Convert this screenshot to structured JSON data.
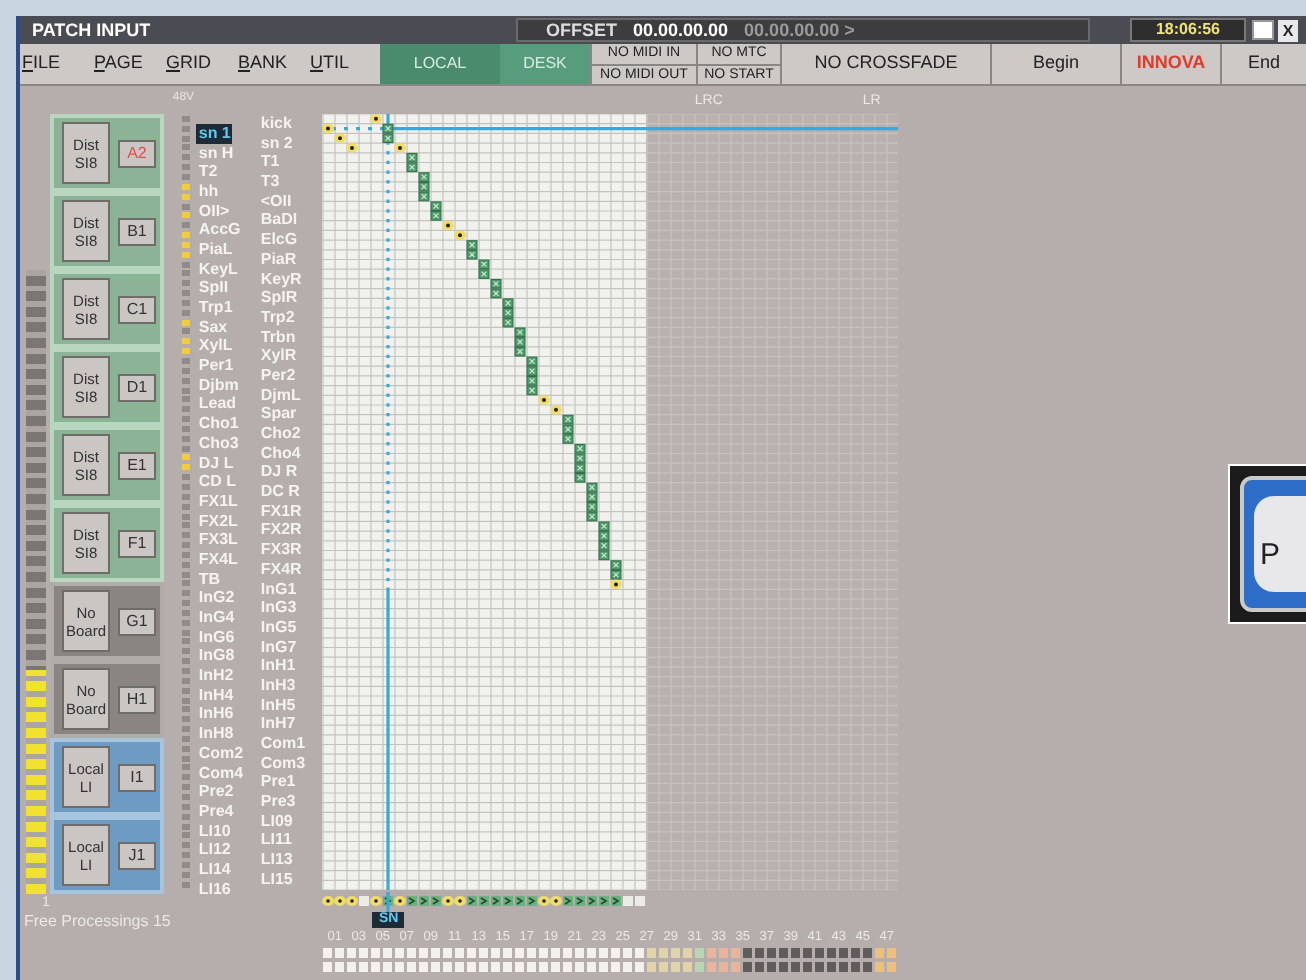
{
  "window": {
    "title": "PATCH INPUT"
  },
  "offset": {
    "label": "OFFSET",
    "value": "00.00.00.00",
    "secondary": "00.00.00.00 >"
  },
  "clock": "18:06:56",
  "title_buttons": [
    {
      "kind": "blank"
    },
    {
      "kind": "close",
      "text": "X"
    }
  ],
  "menu": [
    "FILE",
    "PAGE",
    "GRID",
    "BANK",
    "UTIL"
  ],
  "tabs": [
    {
      "label": "LOCAL",
      "selected": true
    },
    {
      "label": "DESK",
      "selected": false
    }
  ],
  "status": [
    {
      "kind": "stack",
      "lines": [
        "NO MIDI IN",
        "NO MIDI OUT"
      ]
    },
    {
      "kind": "stack",
      "lines": [
        "NO MTC",
        "NO START"
      ]
    },
    {
      "kind": "plain",
      "text": "NO CROSSFADE"
    },
    {
      "kind": "plain",
      "text": "Begin"
    },
    {
      "kind": "brand",
      "text": "INNOVA"
    },
    {
      "kind": "plain",
      "text": "End"
    }
  ],
  "meter": {
    "level": 0.36,
    "label": "1"
  },
  "banks": [
    {
      "card": "Dist SI8",
      "slot": "A2",
      "kind": "dist",
      "highlighted": true
    },
    {
      "card": "Dist SI8",
      "slot": "B1",
      "kind": "dist",
      "highlighted": false
    },
    {
      "card": "Dist SI8",
      "slot": "C1",
      "kind": "dist",
      "highlighted": false
    },
    {
      "card": "Dist SI8",
      "slot": "D1",
      "kind": "dist",
      "highlighted": false
    },
    {
      "card": "Dist SI8",
      "slot": "E1",
      "kind": "dist",
      "highlighted": false
    },
    {
      "card": "Dist SI8",
      "slot": "F1",
      "kind": "dist",
      "highlighted": false
    },
    {
      "card": "No Board",
      "slot": "G1",
      "kind": "none",
      "highlighted": false
    },
    {
      "card": "No Board",
      "slot": "H1",
      "kind": "none",
      "highlighted": false
    },
    {
      "card": "Local LI",
      "slot": "I1",
      "kind": "local",
      "highlighted": false
    },
    {
      "card": "Local LI",
      "slot": "J1",
      "kind": "local",
      "highlighted": false
    }
  ],
  "free_processings": "Free Processings 15",
  "indicator_header": "48V",
  "channels": [
    {
      "name": "kick",
      "selected": false,
      "lit": false,
      "links": [
        false,
        false,
        false,
        false,
        true
      ]
    },
    {
      "name": "sn 1",
      "selected": true,
      "lit": false,
      "links": [
        true
      ],
      "crosses": [
        false,
        false,
        false,
        false,
        false,
        true
      ]
    },
    {
      "name": "sn 2",
      "selected": false,
      "lit": false,
      "links": [
        false,
        true
      ],
      "crosses": [
        false,
        false,
        false,
        false,
        false,
        true
      ]
    },
    {
      "name": "sn H",
      "selected": false,
      "lit": false,
      "links": [
        false,
        false,
        true,
        false,
        false,
        false,
        true
      ]
    },
    {
      "name": "T1",
      "selected": false,
      "lit": false,
      "crosses": [
        false,
        false,
        false,
        false,
        false,
        false,
        false,
        true
      ]
    },
    {
      "name": "T2",
      "selected": false,
      "lit": false,
      "crosses": [
        false,
        false,
        false,
        false,
        false,
        false,
        false,
        true
      ]
    },
    {
      "name": "T3",
      "selected": false,
      "lit": false,
      "crosses": [
        false,
        false,
        false,
        false,
        false,
        false,
        false,
        false,
        true
      ]
    },
    {
      "name": "hh",
      "selected": false,
      "lit": true,
      "crosses": [
        false,
        false,
        false,
        false,
        false,
        false,
        false,
        false,
        true
      ]
    },
    {
      "name": "<OII",
      "selected": false,
      "lit": true,
      "crosses": [
        false,
        false,
        false,
        false,
        false,
        false,
        false,
        false,
        true
      ]
    },
    {
      "name": "OII>",
      "selected": false,
      "lit": false,
      "crosses": [
        false,
        false,
        false,
        false,
        false,
        false,
        false,
        false,
        false,
        true
      ]
    },
    {
      "name": "BaDI",
      "selected": false,
      "lit": true,
      "crosses": [
        false,
        false,
        false,
        false,
        false,
        false,
        false,
        false,
        false,
        true
      ]
    },
    {
      "name": "AccG",
      "selected": false,
      "lit": false,
      "links": [
        false,
        false,
        false,
        false,
        false,
        false,
        false,
        false,
        false,
        false,
        true
      ]
    },
    {
      "name": "ElcG",
      "selected": false,
      "lit": true,
      "links": [
        false,
        false,
        false,
        false,
        false,
        false,
        false,
        false,
        false,
        false,
        false,
        true
      ]
    },
    {
      "name": "PiaL",
      "selected": false,
      "lit": true,
      "crosses": [
        false,
        false,
        false,
        false,
        false,
        false,
        false,
        false,
        false,
        false,
        false,
        false,
        true
      ]
    },
    {
      "name": "PiaR",
      "selected": false,
      "lit": true,
      "crosses": [
        false,
        false,
        false,
        false,
        false,
        false,
        false,
        false,
        false,
        false,
        false,
        false,
        true
      ]
    },
    {
      "name": "KeyL",
      "selected": false,
      "lit": false,
      "crosses": [
        false,
        false,
        false,
        false,
        false,
        false,
        false,
        false,
        false,
        false,
        false,
        false,
        false,
        true
      ]
    },
    {
      "name": "KeyR",
      "selected": false,
      "lit": false,
      "crosses": [
        false,
        false,
        false,
        false,
        false,
        false,
        false,
        false,
        false,
        false,
        false,
        false,
        false,
        true
      ]
    },
    {
      "name": "SpII",
      "selected": false,
      "lit": false,
      "crosses": [
        false,
        false,
        false,
        false,
        false,
        false,
        false,
        false,
        false,
        false,
        false,
        false,
        false,
        false,
        true
      ]
    },
    {
      "name": "SpIR",
      "selected": false,
      "lit": false,
      "crosses": [
        false,
        false,
        false,
        false,
        false,
        false,
        false,
        false,
        false,
        false,
        false,
        false,
        false,
        false,
        true
      ]
    },
    {
      "name": "Trp1",
      "selected": false,
      "lit": false,
      "crosses": [
        false,
        false,
        false,
        false,
        false,
        false,
        false,
        false,
        false,
        false,
        false,
        false,
        false,
        false,
        false,
        true
      ]
    },
    {
      "name": "Trp2",
      "selected": false,
      "lit": false,
      "crosses": [
        false,
        false,
        false,
        false,
        false,
        false,
        false,
        false,
        false,
        false,
        false,
        false,
        false,
        false,
        false,
        true
      ]
    },
    {
      "name": "Sax",
      "selected": false,
      "lit": true,
      "crosses": [
        false,
        false,
        false,
        false,
        false,
        false,
        false,
        false,
        false,
        false,
        false,
        false,
        false,
        false,
        false,
        true
      ]
    },
    {
      "name": "Trbn",
      "selected": false,
      "lit": false,
      "crosses": [
        false,
        false,
        false,
        false,
        false,
        false,
        false,
        false,
        false,
        false,
        false,
        false,
        false,
        false,
        false,
        false,
        true
      ]
    },
    {
      "name": "XylL",
      "selected": false,
      "lit": true,
      "crosses": [
        false,
        false,
        false,
        false,
        false,
        false,
        false,
        false,
        false,
        false,
        false,
        false,
        false,
        false,
        false,
        false,
        true
      ]
    },
    {
      "name": "XylR",
      "selected": false,
      "lit": true,
      "crosses": [
        false,
        false,
        false,
        false,
        false,
        false,
        false,
        false,
        false,
        false,
        false,
        false,
        false,
        false,
        false,
        false,
        true
      ]
    },
    {
      "name": "Per1",
      "selected": false,
      "lit": false,
      "crosses": [
        false,
        false,
        false,
        false,
        false,
        false,
        false,
        false,
        false,
        false,
        false,
        false,
        false,
        false,
        false,
        false,
        false,
        true
      ]
    },
    {
      "name": "Per2",
      "selected": false,
      "lit": false,
      "crosses": [
        false,
        false,
        false,
        false,
        false,
        false,
        false,
        false,
        false,
        false,
        false,
        false,
        false,
        false,
        false,
        false,
        false,
        true
      ]
    },
    {
      "name": "Djbm",
      "selected": false,
      "lit": false,
      "crosses": [
        false,
        false,
        false,
        false,
        false,
        false,
        false,
        false,
        false,
        false,
        false,
        false,
        false,
        false,
        false,
        false,
        false,
        true
      ]
    },
    {
      "name": "DjmL",
      "selected": false,
      "lit": false,
      "crosses": [
        false,
        false,
        false,
        false,
        false,
        false,
        false,
        false,
        false,
        false,
        false,
        false,
        false,
        false,
        false,
        false,
        false,
        true
      ]
    },
    {
      "name": "Lead",
      "selected": false,
      "lit": false,
      "links": [
        false,
        false,
        false,
        false,
        false,
        false,
        false,
        false,
        false,
        false,
        false,
        false,
        false,
        false,
        false,
        false,
        false,
        false,
        true
      ]
    },
    {
      "name": "Spar",
      "selected": false,
      "lit": false,
      "links": [
        false,
        false,
        false,
        false,
        false,
        false,
        false,
        false,
        false,
        false,
        false,
        false,
        false,
        false,
        false,
        false,
        false,
        false,
        false,
        true
      ]
    },
    {
      "name": "Cho1",
      "selected": false,
      "lit": false,
      "crosses": [
        false,
        false,
        false,
        false,
        false,
        false,
        false,
        false,
        false,
        false,
        false,
        false,
        false,
        false,
        false,
        false,
        false,
        false,
        false,
        false,
        true
      ]
    },
    {
      "name": "Cho2",
      "selected": false,
      "lit": false,
      "crosses": [
        false,
        false,
        false,
        false,
        false,
        false,
        false,
        false,
        false,
        false,
        false,
        false,
        false,
        false,
        false,
        false,
        false,
        false,
        false,
        false,
        true
      ]
    },
    {
      "name": "Cho3",
      "selected": false,
      "lit": false,
      "crosses": [
        false,
        false,
        false,
        false,
        false,
        false,
        false,
        false,
        false,
        false,
        false,
        false,
        false,
        false,
        false,
        false,
        false,
        false,
        false,
        false,
        true
      ]
    },
    {
      "name": "Cho4",
      "selected": false,
      "lit": false,
      "crosses": [
        false,
        false,
        false,
        false,
        false,
        false,
        false,
        false,
        false,
        false,
        false,
        false,
        false,
        false,
        false,
        false,
        false,
        false,
        false,
        false,
        false,
        true
      ]
    },
    {
      "name": "DJ L",
      "selected": false,
      "lit": true,
      "crosses": [
        false,
        false,
        false,
        false,
        false,
        false,
        false,
        false,
        false,
        false,
        false,
        false,
        false,
        false,
        false,
        false,
        false,
        false,
        false,
        false,
        false,
        true
      ]
    },
    {
      "name": "DJ R",
      "selected": false,
      "lit": true,
      "crosses": [
        false,
        false,
        false,
        false,
        false,
        false,
        false,
        false,
        false,
        false,
        false,
        false,
        false,
        false,
        false,
        false,
        false,
        false,
        false,
        false,
        false,
        true
      ]
    },
    {
      "name": "CD L",
      "selected": false,
      "lit": false,
      "crosses": [
        false,
        false,
        false,
        false,
        false,
        false,
        false,
        false,
        false,
        false,
        false,
        false,
        false,
        false,
        false,
        false,
        false,
        false,
        false,
        false,
        false,
        true
      ]
    },
    {
      "name": "DC R",
      "selected": false,
      "lit": false,
      "crosses": [
        false,
        false,
        false,
        false,
        false,
        false,
        false,
        false,
        false,
        false,
        false,
        false,
        false,
        false,
        false,
        false,
        false,
        false,
        false,
        false,
        false,
        false,
        true
      ]
    },
    {
      "name": "FX1L",
      "selected": false,
      "lit": false,
      "crosses": [
        false,
        false,
        false,
        false,
        false,
        false,
        false,
        false,
        false,
        false,
        false,
        false,
        false,
        false,
        false,
        false,
        false,
        false,
        false,
        false,
        false,
        false,
        true
      ]
    },
    {
      "name": "FX1R",
      "selected": false,
      "lit": false,
      "crosses": [
        false,
        false,
        false,
        false,
        false,
        false,
        false,
        false,
        false,
        false,
        false,
        false,
        false,
        false,
        false,
        false,
        false,
        false,
        false,
        false,
        false,
        false,
        true
      ]
    },
    {
      "name": "FX2L",
      "selected": false,
      "lit": false,
      "crosses": [
        false,
        false,
        false,
        false,
        false,
        false,
        false,
        false,
        false,
        false,
        false,
        false,
        false,
        false,
        false,
        false,
        false,
        false,
        false,
        false,
        false,
        false,
        true
      ]
    },
    {
      "name": "FX2R",
      "selected": false,
      "lit": false,
      "crosses": [
        false,
        false,
        false,
        false,
        false,
        false,
        false,
        false,
        false,
        false,
        false,
        false,
        false,
        false,
        false,
        false,
        false,
        false,
        false,
        false,
        false,
        false,
        false,
        true
      ]
    },
    {
      "name": "FX3L",
      "selected": false,
      "lit": false,
      "crosses": [
        false,
        false,
        false,
        false,
        false,
        false,
        false,
        false,
        false,
        false,
        false,
        false,
        false,
        false,
        false,
        false,
        false,
        false,
        false,
        false,
        false,
        false,
        false,
        true
      ]
    },
    {
      "name": "FX3R",
      "selected": false,
      "lit": false,
      "crosses": [
        false,
        false,
        false,
        false,
        false,
        false,
        false,
        false,
        false,
        false,
        false,
        false,
        false,
        false,
        false,
        false,
        false,
        false,
        false,
        false,
        false,
        false,
        false,
        true
      ]
    },
    {
      "name": "FX4L",
      "selected": false,
      "lit": false,
      "crosses": [
        false,
        false,
        false,
        false,
        false,
        false,
        false,
        false,
        false,
        false,
        false,
        false,
        false,
        false,
        false,
        false,
        false,
        false,
        false,
        false,
        false,
        false,
        false,
        true
      ]
    },
    {
      "name": "FX4R",
      "selected": false,
      "lit": false,
      "crosses": [
        false,
        false,
        false,
        false,
        false,
        false,
        false,
        false,
        false,
        false,
        false,
        false,
        false,
        false,
        false,
        false,
        false,
        false,
        false,
        false,
        false,
        false,
        false,
        false,
        true
      ]
    },
    {
      "name": "TB",
      "selected": false,
      "lit": false,
      "crosses": [
        false,
        false,
        false,
        false,
        false,
        false,
        false,
        false,
        false,
        false,
        false,
        false,
        false,
        false,
        false,
        false,
        false,
        false,
        false,
        false,
        false,
        false,
        false,
        false,
        true
      ]
    },
    {
      "name": "InG1",
      "selected": false,
      "lit": false,
      "links": [
        false,
        false,
        false,
        false,
        false,
        false,
        false,
        false,
        false,
        false,
        false,
        false,
        false,
        false,
        false,
        false,
        false,
        false,
        false,
        false,
        false,
        false,
        false,
        false,
        true
      ]
    },
    {
      "name": "InG2",
      "selected": false,
      "lit": false
    },
    {
      "name": "InG3",
      "selected": false,
      "lit": false
    },
    {
      "name": "InG4",
      "selected": false,
      "lit": false
    },
    {
      "name": "InG5",
      "selected": false,
      "lit": false
    },
    {
      "name": "InG6",
      "selected": false,
      "lit": false
    },
    {
      "name": "InG7",
      "selected": false,
      "lit": false
    },
    {
      "name": "InG8",
      "selected": false,
      "lit": false
    },
    {
      "name": "InH1",
      "selected": false,
      "lit": false
    },
    {
      "name": "InH2",
      "selected": false,
      "lit": false
    },
    {
      "name": "InH3",
      "selected": false,
      "lit": false
    },
    {
      "name": "InH4",
      "selected": false,
      "lit": false
    },
    {
      "name": "InH5",
      "selected": false,
      "lit": false
    },
    {
      "name": "InH6",
      "selected": false,
      "lit": false
    },
    {
      "name": "InH7",
      "selected": false,
      "lit": false
    },
    {
      "name": "InH8",
      "selected": false,
      "lit": false
    },
    {
      "name": "Com1",
      "selected": false,
      "lit": false
    },
    {
      "name": "Com2",
      "selected": false,
      "lit": false
    },
    {
      "name": "Com3",
      "selected": false,
      "lit": false
    },
    {
      "name": "Com4",
      "selected": false,
      "lit": false
    },
    {
      "name": "Pre1",
      "selected": false,
      "lit": false
    },
    {
      "name": "Pre2",
      "selected": false,
      "lit": false
    },
    {
      "name": "Pre3",
      "selected": false,
      "lit": false
    },
    {
      "name": "Pre4",
      "selected": false,
      "lit": false
    },
    {
      "name": "LI09",
      "selected": false,
      "lit": false
    },
    {
      "name": "LI10",
      "selected": false,
      "lit": false
    },
    {
      "name": "LI11",
      "selected": false,
      "lit": false
    },
    {
      "name": "LI12",
      "selected": false,
      "lit": false
    },
    {
      "name": "LI13",
      "selected": false,
      "lit": false
    },
    {
      "name": "LI14",
      "selected": false,
      "lit": false
    },
    {
      "name": "LI15",
      "selected": false,
      "lit": false
    },
    {
      "name": "LI16",
      "selected": false,
      "lit": false
    }
  ],
  "grid": {
    "cursor_label": "SN",
    "headers": [
      "LRC",
      "LR"
    ],
    "output_labels": [
      "01",
      "03",
      "05",
      "07",
      "09",
      "11",
      "13",
      "15",
      "17",
      "19",
      "21",
      "23",
      "25",
      "27",
      "29",
      "31",
      "33",
      "35",
      "37",
      "39",
      "41",
      "43",
      "45",
      "47"
    ]
  },
  "popup": {
    "text": "P"
  }
}
